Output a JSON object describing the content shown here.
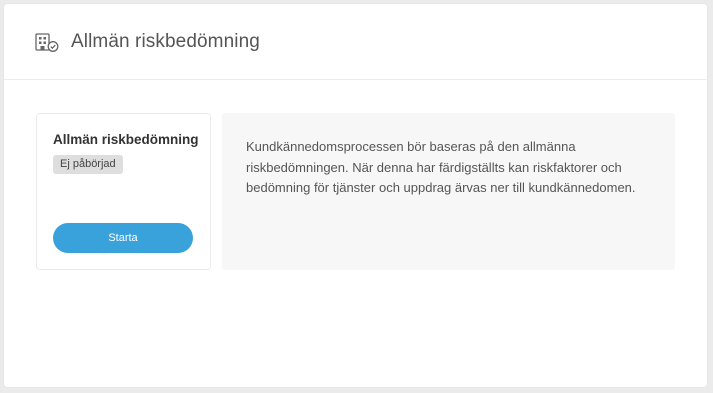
{
  "header": {
    "title": "Allmän riskbedömning",
    "icon": "building-check-icon"
  },
  "card": {
    "title": "Allmän riskbedömning",
    "status": "Ej påbörjad",
    "start_label": "Starta"
  },
  "info": {
    "text": "Kundkännedomsprocessen bör baseras på den allmänna riskbedömningen. När denna har färdigställts kan riskfaktorer och bedömning för tjänster och uppdrag ärvas ner till kundkännedomen."
  },
  "colors": {
    "accent": "#3aa2da",
    "badge_bg": "#dedede",
    "info_bg": "#f7f7f7"
  }
}
